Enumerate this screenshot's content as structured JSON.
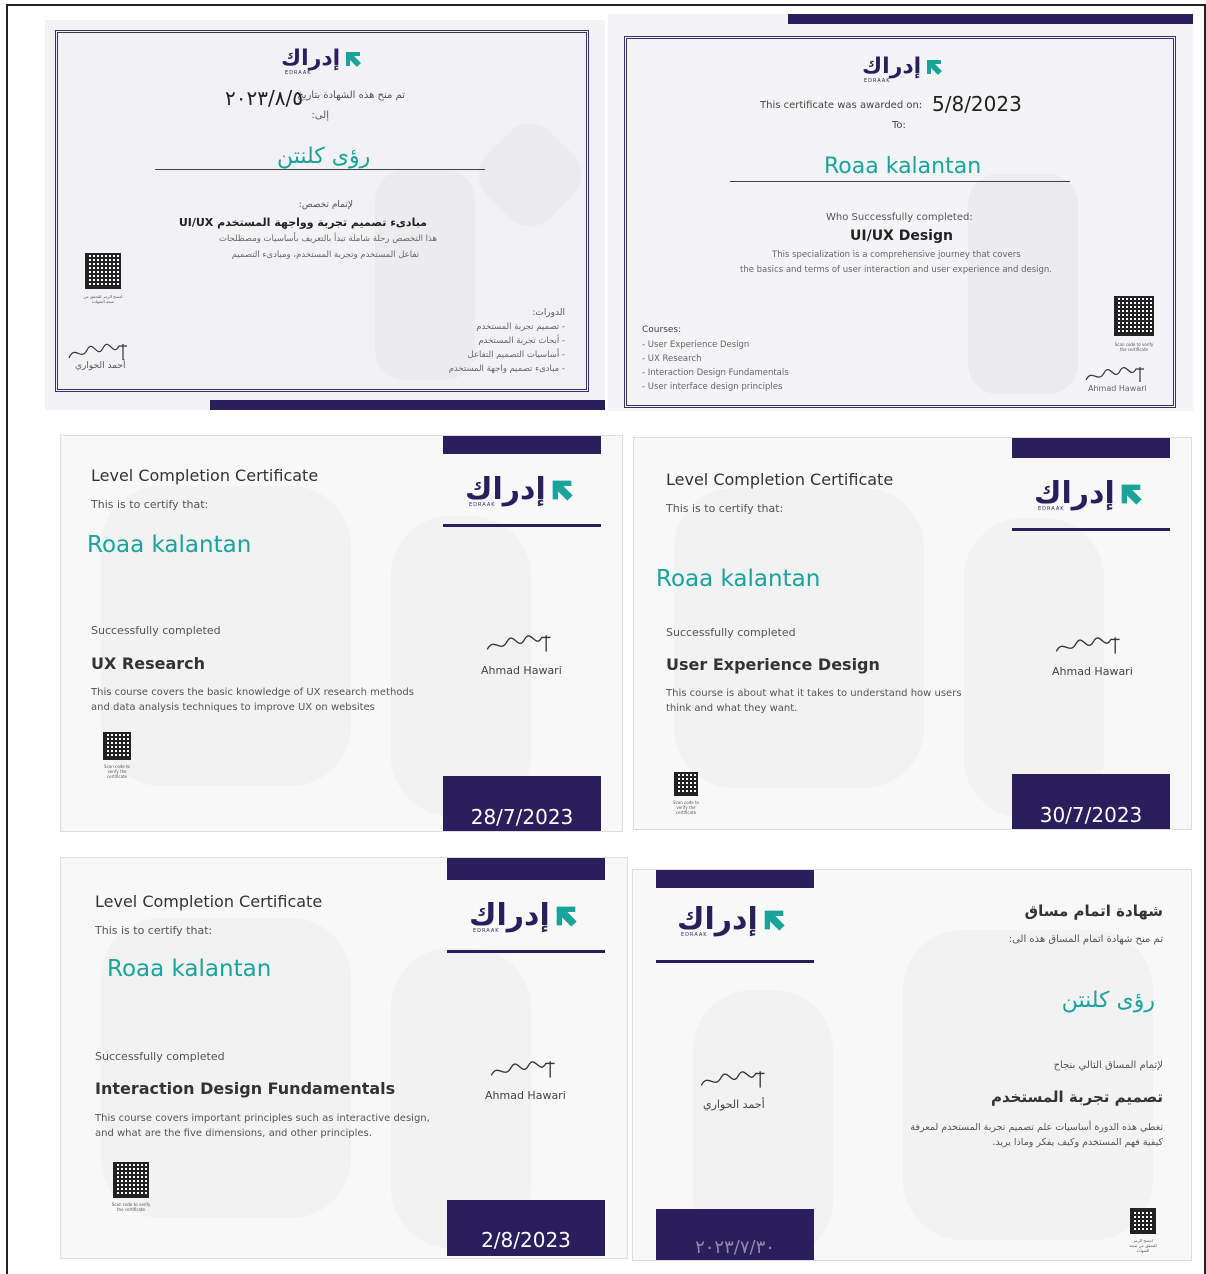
{
  "brand": {
    "logo_ar": "إدراك",
    "logo_en": "EDRAAK",
    "navy": "#2a1f5c",
    "teal": "#1aa39b"
  },
  "c1": {
    "awarded_on": "تم منح هذه الشهادة بتاريخ",
    "date": "٢٠٢٣/٨/٥",
    "to": "إلى:",
    "name": "رؤى كلنتن",
    "for": "لإتمام تخصص:",
    "title": "مبادىء تصميم تجربة وواجهة المستخدم UI/UX",
    "desc1": "هذا التخصص رحلة شاملة تبدأ بالتعريف بأساسيات ومصطلحات",
    "desc2": "تفاعل المستخدم وتجربة المستخدم، ومبادىء التصميم",
    "courses_label": "الدورات:",
    "courses": [
      "- تصميم تجربة المستخدم",
      "- أبحاث تجربة المستخدم",
      "- أساسيات التصميم التفاعل",
      "- مبادىء تصميم واجهة المستخدم"
    ],
    "qr_caption": "امسح الرمز للتحقق من صحة الشهادة",
    "signer": "أحمد الحواري"
  },
  "c2": {
    "awarded_on": "This certificate was awarded on:",
    "date": "5/8/2023",
    "to": "To:",
    "name": "Roaa kalantan",
    "completed": "Who Successfully completed:",
    "title": "UI/UX Design",
    "desc1": "This specialization is a  comprehensive journey that covers",
    "desc2": "the basics and terms of user interaction and user experience and design.",
    "courses_label": "Courses:",
    "courses": [
      "- User Experience Design",
      "- UX Research",
      "- Interaction Design Fundamentals",
      "- User interface design principles"
    ],
    "qr_caption": "Scan code to verify the certificate",
    "signer": "Ahmad Hawari"
  },
  "c3": {
    "heading": "Level Completion Certificate",
    "certify": "This is to certify that:",
    "name": "Roaa kalantan",
    "completed": "Successfully completed",
    "title": "UX Research",
    "desc1": "This course covers the basic knowledge of UX research methods",
    "desc2": " and data analysis techniques to improve UX on websites",
    "qr_caption": "Scan code to verify the certificate",
    "signer": "Ahmad Hawari",
    "date": "28/7/2023"
  },
  "c4": {
    "heading": "Level Completion Certificate",
    "certify": "This is to certify that:",
    "name": "Roaa kalantan",
    "completed": "Successfully completed",
    "title": "User Experience Design",
    "desc1": "This course is about what it takes to understand how users",
    "desc2": "think and what they want.",
    "qr_caption": "Scan code to verify the certificate",
    "signer": "Ahmad Hawari",
    "date": "30/7/2023"
  },
  "c5": {
    "heading": "Level Completion Certificate",
    "certify": "This is to certify that:",
    "name": "Roaa kalantan",
    "completed": "Successfully completed",
    "title": "Interaction Design Fundamentals",
    "desc1": "This course covers important principles such as  interactive design,",
    "desc2": "and what are the five dimensions, and other principles.",
    "qr_caption": "Scan code to verify the certificate",
    "signer": "Ahmad Hawari",
    "date": "2/8/2023"
  },
  "c6": {
    "heading": "شهادة اتمام مساق",
    "awarded": "تم منح شهادة اتمام المساق هذه الى:",
    "name": "رؤى كلنتن",
    "for": "لإتمام المساق التالي بنجاح",
    "title": "تصميم تجربة المستخدم",
    "desc1": "تغطي هذه الدورة أساسيات علم تصميم تجربة المستخدم لمعرفة",
    "desc2": "كيفية فهم المستخدم وكيف يفكر وماذا يريد.",
    "qr_caption": "امسح الرمز للتحقق من صحة الشهادة",
    "signer": "أحمد الحواري",
    "date": "٢٠٢٣/٧/٣٠"
  }
}
